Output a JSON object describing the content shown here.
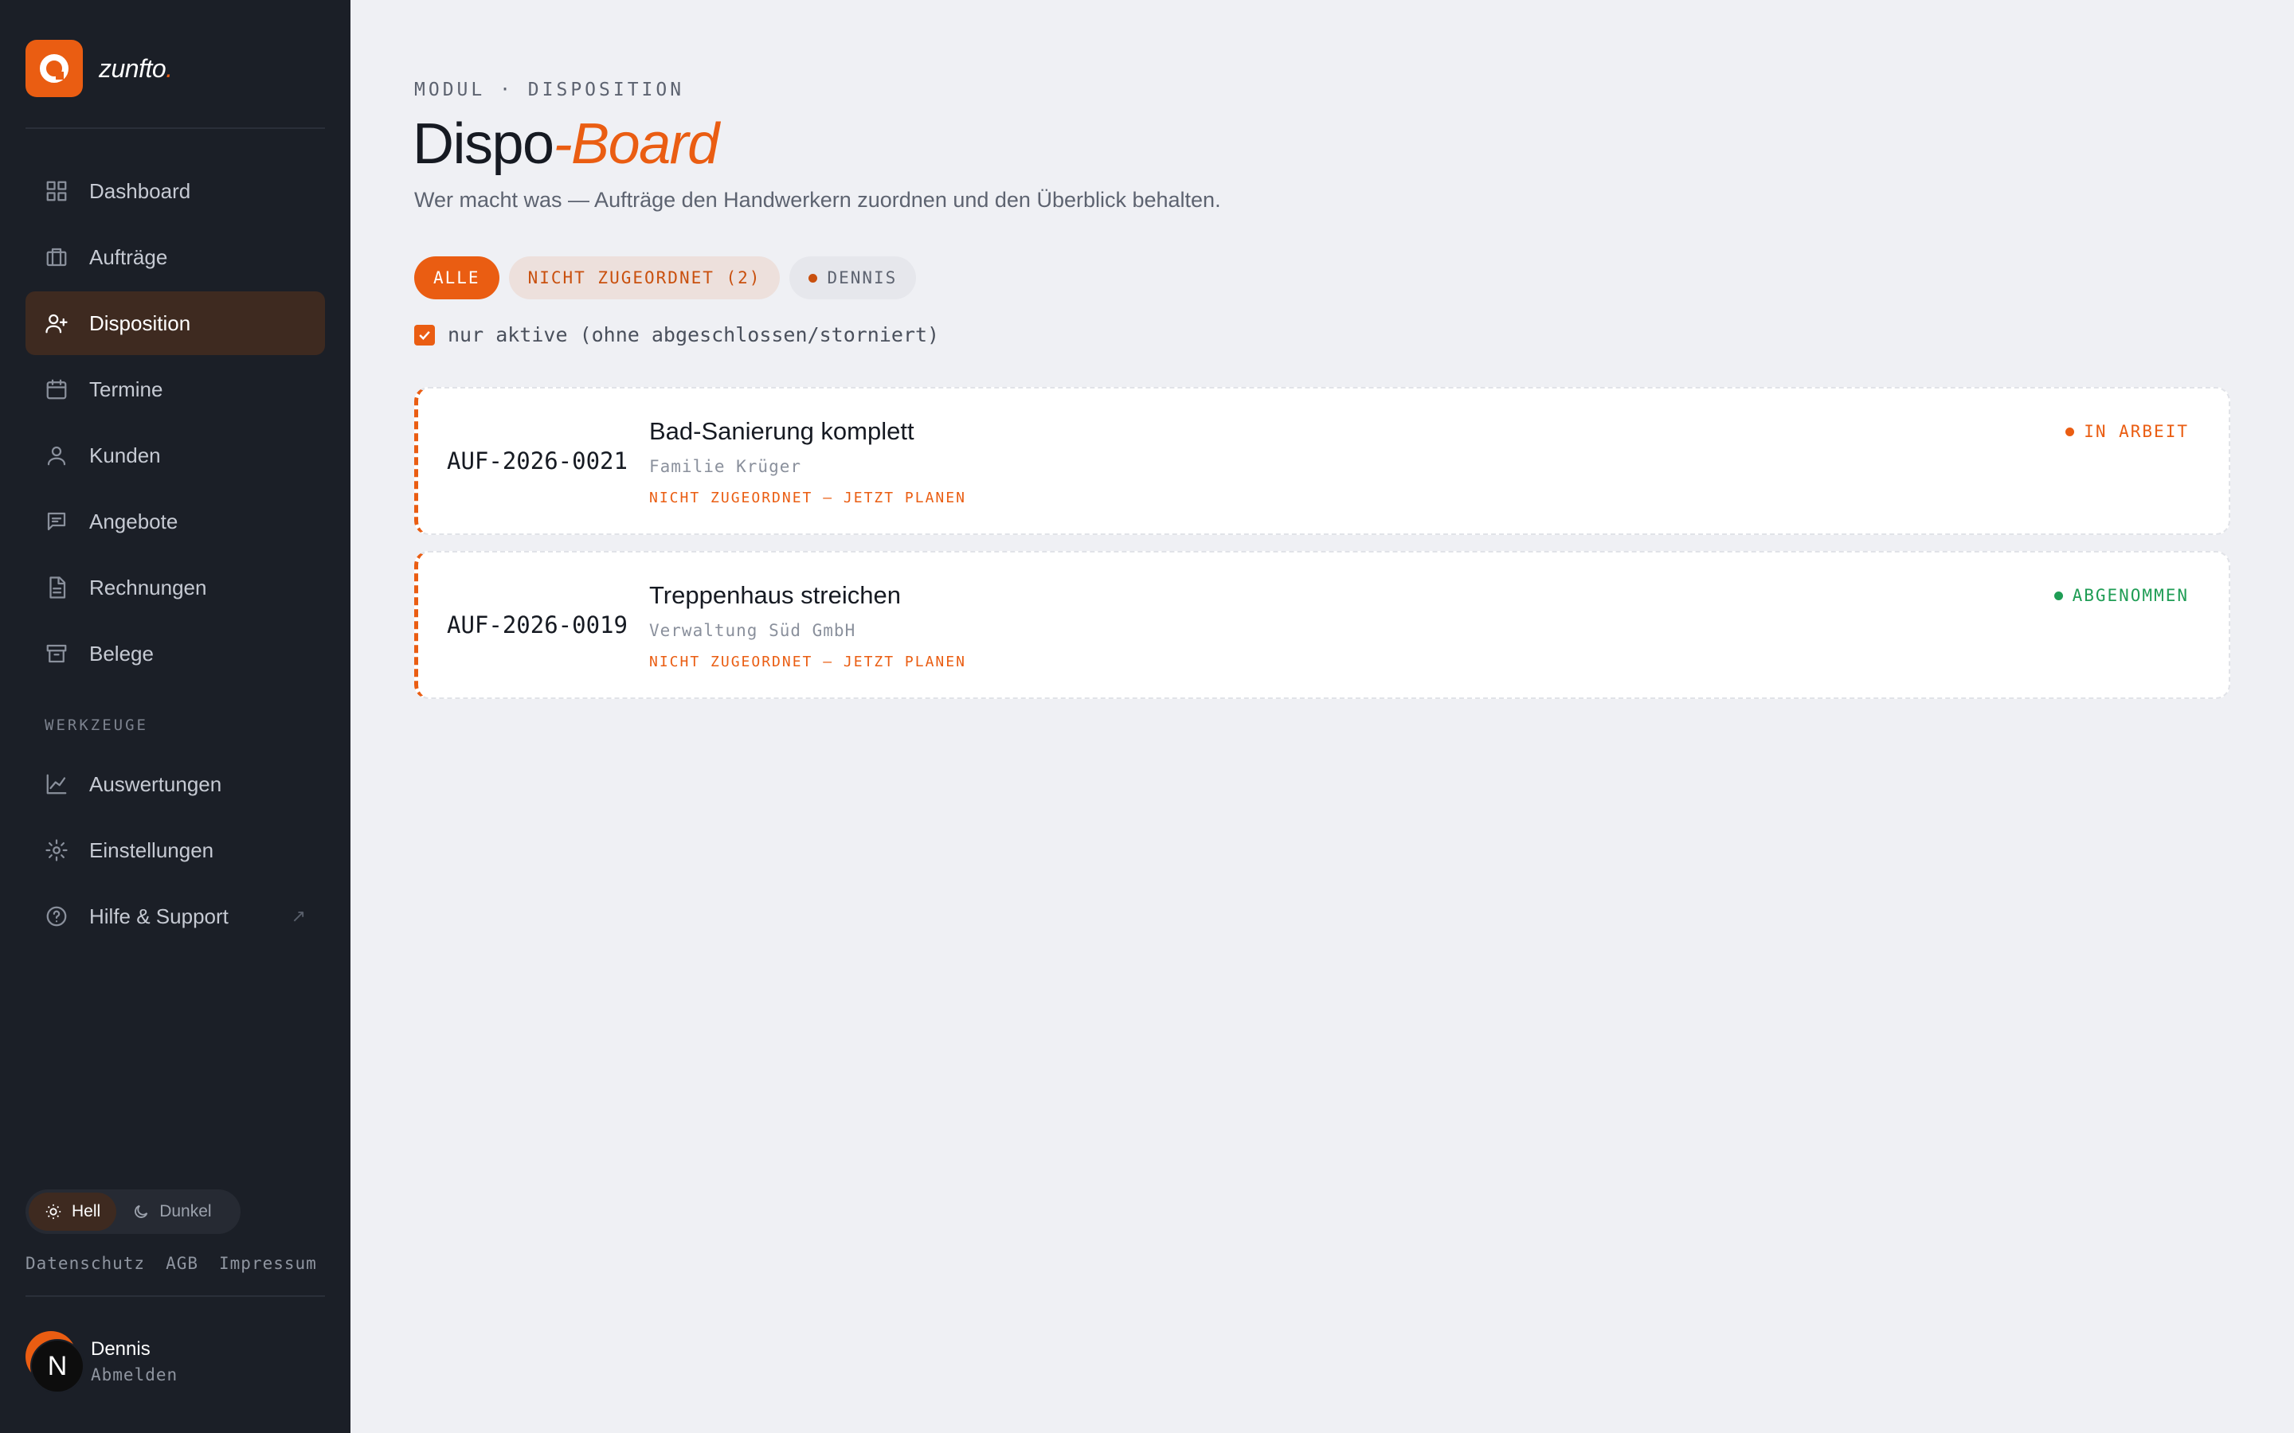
{
  "brand": {
    "name": "zunfto",
    "dot": "."
  },
  "nav": [
    {
      "label": "Dashboard",
      "icon": "grid-icon"
    },
    {
      "label": "Aufträge",
      "icon": "briefcase-icon"
    },
    {
      "label": "Disposition",
      "icon": "user-plus-icon",
      "active": true
    },
    {
      "label": "Termine",
      "icon": "calendar-icon"
    },
    {
      "label": "Kunden",
      "icon": "user-icon"
    },
    {
      "label": "Angebote",
      "icon": "message-icon"
    },
    {
      "label": "Rechnungen",
      "icon": "file-icon"
    },
    {
      "label": "Belege",
      "icon": "archive-icon"
    }
  ],
  "tools_section": "WERKZEUGE",
  "tools": [
    {
      "label": "Auswertungen",
      "icon": "chart-icon"
    },
    {
      "label": "Einstellungen",
      "icon": "gear-icon"
    },
    {
      "label": "Hilfe & Support",
      "icon": "help-icon",
      "external": "↗"
    }
  ],
  "theme": {
    "light": "Hell",
    "dark": "Dunkel",
    "selected": "Hell"
  },
  "legal": [
    "Datenschutz",
    "AGB",
    "Impressum"
  ],
  "user": {
    "initial": "N",
    "name": "Dennis",
    "logout": "Abmelden"
  },
  "header": {
    "eyebrow": "MODUL · DISPOSITION",
    "title_main": "Dispo",
    "title_accent": "-Board",
    "subtitle": "Wer macht was — Aufträge den Handwerkern zuordnen und den Überblick behalten."
  },
  "filters": {
    "all": "ALLE",
    "unassigned": "NICHT ZUGEORDNET (2)",
    "person": "DENNIS"
  },
  "active_only": {
    "label": "nur aktive (ohne abgeschlossen/storniert)",
    "checked": true
  },
  "orders": [
    {
      "id": "AUF-2026-0021",
      "title": "Bad-Sanierung komplett",
      "client": "Familie Krüger",
      "note": "NICHT ZUGEORDNET — JETZT PLANEN",
      "status": "IN ARBEIT",
      "status_color": "#ea5d12"
    },
    {
      "id": "AUF-2026-0019",
      "title": "Treppenhaus streichen",
      "client": "Verwaltung Süd GmbH",
      "note": "NICHT ZUGEORDNET — JETZT PLANEN",
      "status": "ABGENOMMEN",
      "status_color": "#1f9d55"
    }
  ],
  "colors": {
    "accent": "#ea5d12",
    "sidebar": "#1b1f27",
    "background": "#eff0f4"
  }
}
